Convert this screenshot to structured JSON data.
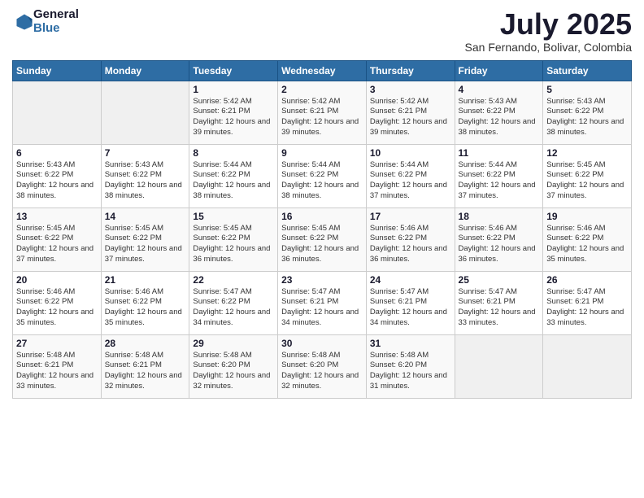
{
  "logo": {
    "general": "General",
    "blue": "Blue"
  },
  "title": {
    "month_year": "July 2025",
    "location": "San Fernando, Bolivar, Colombia"
  },
  "days_of_week": [
    "Sunday",
    "Monday",
    "Tuesday",
    "Wednesday",
    "Thursday",
    "Friday",
    "Saturday"
  ],
  "weeks": [
    [
      {
        "day": "",
        "info": ""
      },
      {
        "day": "",
        "info": ""
      },
      {
        "day": "1",
        "info": "Sunrise: 5:42 AM\nSunset: 6:21 PM\nDaylight: 12 hours\nand 39 minutes."
      },
      {
        "day": "2",
        "info": "Sunrise: 5:42 AM\nSunset: 6:21 PM\nDaylight: 12 hours\nand 39 minutes."
      },
      {
        "day": "3",
        "info": "Sunrise: 5:42 AM\nSunset: 6:21 PM\nDaylight: 12 hours\nand 39 minutes."
      },
      {
        "day": "4",
        "info": "Sunrise: 5:43 AM\nSunset: 6:22 PM\nDaylight: 12 hours\nand 38 minutes."
      },
      {
        "day": "5",
        "info": "Sunrise: 5:43 AM\nSunset: 6:22 PM\nDaylight: 12 hours\nand 38 minutes."
      }
    ],
    [
      {
        "day": "6",
        "info": "Sunrise: 5:43 AM\nSunset: 6:22 PM\nDaylight: 12 hours\nand 38 minutes."
      },
      {
        "day": "7",
        "info": "Sunrise: 5:43 AM\nSunset: 6:22 PM\nDaylight: 12 hours\nand 38 minutes."
      },
      {
        "day": "8",
        "info": "Sunrise: 5:44 AM\nSunset: 6:22 PM\nDaylight: 12 hours\nand 38 minutes."
      },
      {
        "day": "9",
        "info": "Sunrise: 5:44 AM\nSunset: 6:22 PM\nDaylight: 12 hours\nand 38 minutes."
      },
      {
        "day": "10",
        "info": "Sunrise: 5:44 AM\nSunset: 6:22 PM\nDaylight: 12 hours\nand 37 minutes."
      },
      {
        "day": "11",
        "info": "Sunrise: 5:44 AM\nSunset: 6:22 PM\nDaylight: 12 hours\nand 37 minutes."
      },
      {
        "day": "12",
        "info": "Sunrise: 5:45 AM\nSunset: 6:22 PM\nDaylight: 12 hours\nand 37 minutes."
      }
    ],
    [
      {
        "day": "13",
        "info": "Sunrise: 5:45 AM\nSunset: 6:22 PM\nDaylight: 12 hours\nand 37 minutes."
      },
      {
        "day": "14",
        "info": "Sunrise: 5:45 AM\nSunset: 6:22 PM\nDaylight: 12 hours\nand 37 minutes."
      },
      {
        "day": "15",
        "info": "Sunrise: 5:45 AM\nSunset: 6:22 PM\nDaylight: 12 hours\nand 36 minutes."
      },
      {
        "day": "16",
        "info": "Sunrise: 5:45 AM\nSunset: 6:22 PM\nDaylight: 12 hours\nand 36 minutes."
      },
      {
        "day": "17",
        "info": "Sunrise: 5:46 AM\nSunset: 6:22 PM\nDaylight: 12 hours\nand 36 minutes."
      },
      {
        "day": "18",
        "info": "Sunrise: 5:46 AM\nSunset: 6:22 PM\nDaylight: 12 hours\nand 36 minutes."
      },
      {
        "day": "19",
        "info": "Sunrise: 5:46 AM\nSunset: 6:22 PM\nDaylight: 12 hours\nand 35 minutes."
      }
    ],
    [
      {
        "day": "20",
        "info": "Sunrise: 5:46 AM\nSunset: 6:22 PM\nDaylight: 12 hours\nand 35 minutes."
      },
      {
        "day": "21",
        "info": "Sunrise: 5:46 AM\nSunset: 6:22 PM\nDaylight: 12 hours\nand 35 minutes."
      },
      {
        "day": "22",
        "info": "Sunrise: 5:47 AM\nSunset: 6:22 PM\nDaylight: 12 hours\nand 34 minutes."
      },
      {
        "day": "23",
        "info": "Sunrise: 5:47 AM\nSunset: 6:21 PM\nDaylight: 12 hours\nand 34 minutes."
      },
      {
        "day": "24",
        "info": "Sunrise: 5:47 AM\nSunset: 6:21 PM\nDaylight: 12 hours\nand 34 minutes."
      },
      {
        "day": "25",
        "info": "Sunrise: 5:47 AM\nSunset: 6:21 PM\nDaylight: 12 hours\nand 33 minutes."
      },
      {
        "day": "26",
        "info": "Sunrise: 5:47 AM\nSunset: 6:21 PM\nDaylight: 12 hours\nand 33 minutes."
      }
    ],
    [
      {
        "day": "27",
        "info": "Sunrise: 5:48 AM\nSunset: 6:21 PM\nDaylight: 12 hours\nand 33 minutes."
      },
      {
        "day": "28",
        "info": "Sunrise: 5:48 AM\nSunset: 6:21 PM\nDaylight: 12 hours\nand 32 minutes."
      },
      {
        "day": "29",
        "info": "Sunrise: 5:48 AM\nSunset: 6:20 PM\nDaylight: 12 hours\nand 32 minutes."
      },
      {
        "day": "30",
        "info": "Sunrise: 5:48 AM\nSunset: 6:20 PM\nDaylight: 12 hours\nand 32 minutes."
      },
      {
        "day": "31",
        "info": "Sunrise: 5:48 AM\nSunset: 6:20 PM\nDaylight: 12 hours\nand 31 minutes."
      },
      {
        "day": "",
        "info": ""
      },
      {
        "day": "",
        "info": ""
      }
    ]
  ]
}
